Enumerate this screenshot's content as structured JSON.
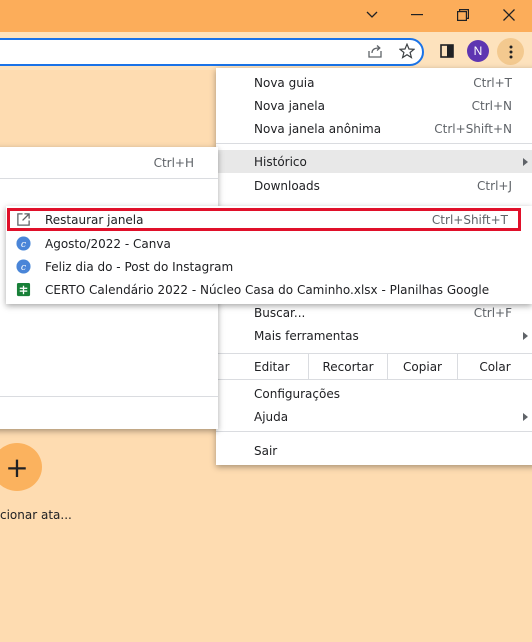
{
  "colors": {
    "titlebar": "#fcad5a",
    "page_bg": "#fedcb1",
    "highlight": "#e0102a",
    "avatar": "#5e35b1",
    "canva": "#2fb6cf",
    "sheets": "#188038"
  },
  "titlebar": {
    "icons": [
      "chevron-down-icon",
      "minimize-icon",
      "restore-icon",
      "close-icon"
    ]
  },
  "toolbar": {
    "avatar_letter": "N",
    "icons": [
      "share-icon",
      "star-icon",
      "side-panel-icon",
      "more-vertical-icon"
    ]
  },
  "main_menu": {
    "new_tab": {
      "label": "Nova guia",
      "shortcut": "Ctrl+T"
    },
    "new_window": {
      "label": "Nova janela",
      "shortcut": "Ctrl+N"
    },
    "incognito": {
      "label": "Nova janela anônima",
      "shortcut": "Ctrl+Shift+N"
    },
    "history": {
      "label": "Histórico"
    },
    "downloads": {
      "label": "Downloads",
      "shortcut": "Ctrl+J"
    },
    "find": {
      "label": "Buscar...",
      "shortcut": "Ctrl+F"
    },
    "more_tools": {
      "label": "Mais ferramentas"
    },
    "edit": {
      "label": "Editar",
      "cut": "Recortar",
      "copy": "Copiar",
      "paste": "Colar"
    },
    "settings": {
      "label": "Configurações"
    },
    "help": {
      "label": "Ajuda"
    },
    "exit": {
      "label": "Sair"
    }
  },
  "history_menu": {
    "shortcut": "Ctrl+H"
  },
  "recent_menu": {
    "items": [
      {
        "label": "Restaurar janela",
        "shortcut": "Ctrl+Shift+T",
        "icon": "restore-window-icon"
      },
      {
        "label": "Agosto/2022 - Canva",
        "icon": "canva-icon"
      },
      {
        "label": "Feliz dia do - Post do Instagram",
        "icon": "canva-icon"
      },
      {
        "label": "CERTO Calendário 2022 - Núcleo Casa do Caminho.xlsx - Planilhas Google",
        "icon": "sheets-icon"
      }
    ]
  },
  "page": {
    "add_shortcut_symbol": "+",
    "add_shortcut_label": "cionar ata..."
  }
}
